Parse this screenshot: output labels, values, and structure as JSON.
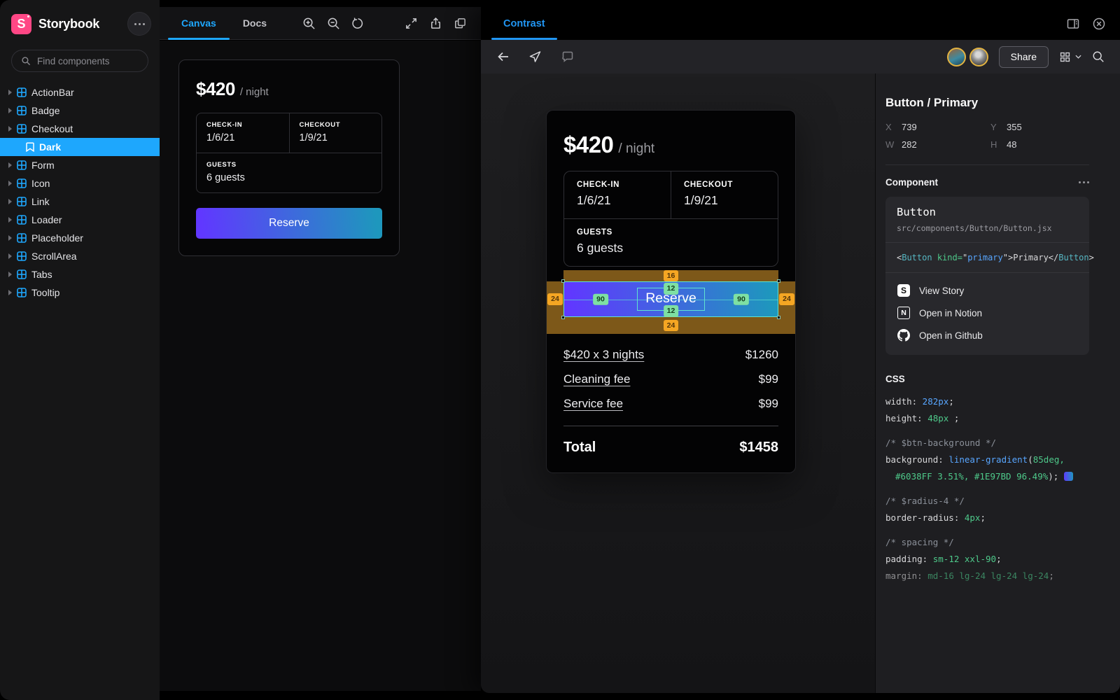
{
  "sidebar": {
    "logo_letter": "S",
    "brand": "Storybook",
    "search_placeholder": "Find components",
    "items": [
      {
        "label": "ActionBar",
        "type": "component"
      },
      {
        "label": "Badge",
        "type": "component"
      },
      {
        "label": "Checkout",
        "type": "component",
        "expanded": true
      },
      {
        "label": "Dark",
        "type": "story",
        "selected": true
      },
      {
        "label": "Form",
        "type": "component"
      },
      {
        "label": "Icon",
        "type": "component"
      },
      {
        "label": "Link",
        "type": "component"
      },
      {
        "label": "Loader",
        "type": "component"
      },
      {
        "label": "Placeholder",
        "type": "component"
      },
      {
        "label": "ScrollArea",
        "type": "component"
      },
      {
        "label": "Tabs",
        "type": "component"
      },
      {
        "label": "Tooltip",
        "type": "component"
      }
    ]
  },
  "preview": {
    "tabs": [
      {
        "label": "Canvas",
        "active": true
      },
      {
        "label": "Docs",
        "active": false
      }
    ]
  },
  "booking": {
    "price": "$420",
    "per": "/ night",
    "checkin_label": "CHECK-IN",
    "checkin_value": "1/6/21",
    "checkout_label": "CHECKOUT",
    "checkout_value": "1/9/21",
    "guests_label": "GUESTS",
    "guests_value": "6 guests",
    "reserve_label": "Reserve",
    "breakdown": [
      {
        "label": "$420 x 3 nights",
        "value": "$1260"
      },
      {
        "label": "Cleaning fee",
        "value": "$99"
      },
      {
        "label": "Service fee",
        "value": "$99"
      }
    ],
    "total_label": "Total",
    "total_value": "$1458"
  },
  "contrast": {
    "tab": "Contrast",
    "share_label": "Share"
  },
  "overlay": {
    "margin_top": "16",
    "margin_left": "24",
    "margin_right": "24",
    "margin_bottom": "24",
    "pad_top": "12",
    "pad_bottom": "12",
    "pad_left": "90",
    "pad_right": "90"
  },
  "inspector": {
    "title": "Button / Primary",
    "position": {
      "x_label": "X",
      "x": "739",
      "y_label": "Y",
      "y": "355",
      "w_label": "W",
      "w": "282",
      "h_label": "H",
      "h": "48"
    },
    "component_header": "Component",
    "component_name": "Button",
    "component_path": "src/components/Button/Button.jsx",
    "code_tokens": [
      {
        "t": "<",
        "c": "plain"
      },
      {
        "t": "Button",
        "c": "tag"
      },
      {
        "t": " ",
        "c": "plain"
      },
      {
        "t": "kind=",
        "c": "green"
      },
      {
        "t": "\"",
        "c": "plain"
      },
      {
        "t": "primary",
        "c": "blue"
      },
      {
        "t": "\"",
        "c": "plain"
      },
      {
        "t": ">Primary</",
        "c": "plain"
      },
      {
        "t": "Button",
        "c": "tag"
      },
      {
        "t": ">",
        "c": "plain"
      }
    ],
    "links": [
      {
        "label": "View Story",
        "icon": "storybook-icon"
      },
      {
        "label": "Open in Notion",
        "icon": "notion-icon"
      },
      {
        "label": "Open in Github",
        "icon": "github-icon"
      }
    ],
    "css_header": "CSS",
    "css_lines": [
      {
        "tokens": [
          {
            "t": "width:",
            "c": "plain"
          },
          {
            "t": " 282px",
            "c": "blue"
          },
          {
            "t": ";",
            "c": "plain"
          }
        ]
      },
      {
        "tokens": [
          {
            "t": "height:",
            "c": "plain"
          },
          {
            "t": " 48px",
            "c": "green"
          },
          {
            "t": " ;",
            "c": "plain"
          }
        ]
      },
      {
        "gap": true,
        "tokens": [
          {
            "t": "/* $btn-background */",
            "c": "comment"
          }
        ]
      },
      {
        "tokens": [
          {
            "t": "background:",
            "c": "plain"
          },
          {
            "t": " linear-gradient",
            "c": "blue"
          },
          {
            "t": "(",
            "c": "plain"
          },
          {
            "t": "85deg,",
            "c": "green"
          }
        ]
      },
      {
        "indent": true,
        "swatch": true,
        "tokens": [
          {
            "t": "#6038FF 3.51%, #1E97BD 96.49%",
            "c": "green"
          },
          {
            "t": ");",
            "c": "plain"
          }
        ]
      },
      {
        "gap": true,
        "tokens": [
          {
            "t": "/* $radius-4 */",
            "c": "comment"
          }
        ]
      },
      {
        "tokens": [
          {
            "t": "border-radius:",
            "c": "plain"
          },
          {
            "t": " 4px",
            "c": "green"
          },
          {
            "t": ";",
            "c": "plain"
          }
        ]
      },
      {
        "gap": true,
        "tokens": [
          {
            "t": "/* spacing */",
            "c": "comment"
          }
        ]
      },
      {
        "tokens": [
          {
            "t": "padding:",
            "c": "plain"
          },
          {
            "t": " sm-12 xxl-90",
            "c": "green"
          },
          {
            "t": ";",
            "c": "plain"
          }
        ]
      },
      {
        "dim": true,
        "tokens": [
          {
            "t": "margin:",
            "c": "plain"
          },
          {
            "t": " md-16 lg-24 lg-24 lg-24",
            "c": "green"
          },
          {
            "t": ";",
            "c": "plain"
          }
        ]
      }
    ]
  },
  "colors": {
    "brand_pink": "#FF4785",
    "accent_blue": "#1EA7FD",
    "contrast_blue": "#2196F3",
    "gradient_start": "#6038FF",
    "gradient_end": "#1E97BD",
    "margin_overlay_orange": "#F5A623",
    "padding_badge_green": "#7EE0A3",
    "selection_teal": "#5FE3D0",
    "avatar_ring_gold": "#E3B341"
  }
}
